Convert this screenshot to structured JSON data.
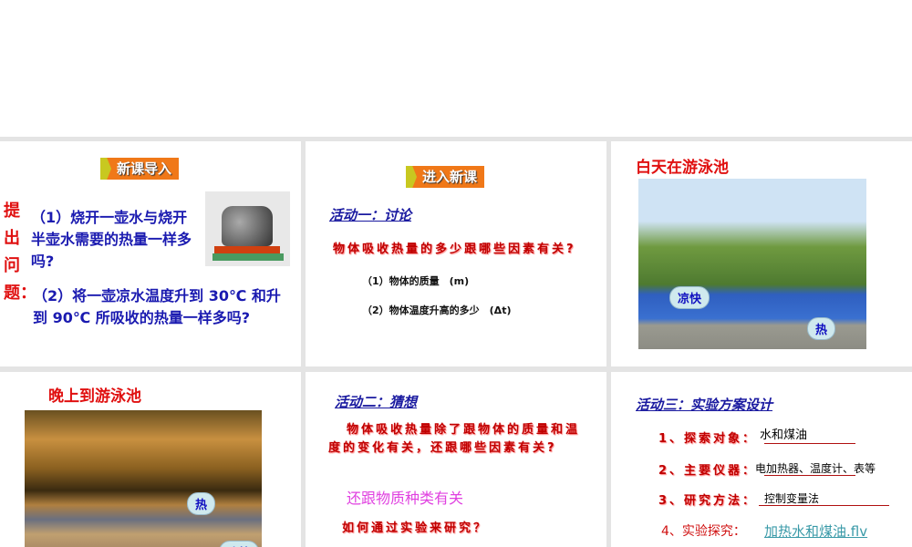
{
  "slide1": {
    "banner": "新课导入",
    "side_label": [
      "提",
      "出",
      "问",
      "题："
    ],
    "q1": "（1）烧开一壶水与烧开半壶水需要的热量一样多吗?",
    "q2": "（2）将一壶凉水温度升到 30℃ 和升到 90℃ 所吸收的热量一样多吗?",
    "image": "kettle-on-stove"
  },
  "slide2": {
    "banner": "进入新课",
    "activity": "活动一：讨论",
    "question": "物体吸收热量的多少跟哪些因素有关?",
    "factors": [
      "（1）物体的质量　(m)",
      "（2）物体温度升高的多少　(Δt)"
    ]
  },
  "slide3": {
    "title": "白天在游泳池",
    "bubbles": [
      "凉快",
      "热"
    ]
  },
  "slide4": {
    "title": "晚上到游泳池",
    "bubbles": [
      "热",
      "凉快"
    ]
  },
  "slide5": {
    "activity": "活动二：猜想",
    "question": "物体吸收热量除了跟物体的质量和温度的变化有关，还跟哪些因素有关?",
    "answer": "还跟物质种类有关",
    "prompt": "如何通过实验来研究？"
  },
  "slide6": {
    "activity": "活动三：实验方案设计",
    "items": [
      {
        "label": "1、探索对象：",
        "value": "水和煤油"
      },
      {
        "label": "2、主要仪器：",
        "value": "电加热器、温度计、表等"
      },
      {
        "label": "3、研究方法：",
        "value": "控制变量法"
      },
      {
        "label": "4、实验探究：",
        "value": "加热水和煤油.flv"
      }
    ]
  }
}
